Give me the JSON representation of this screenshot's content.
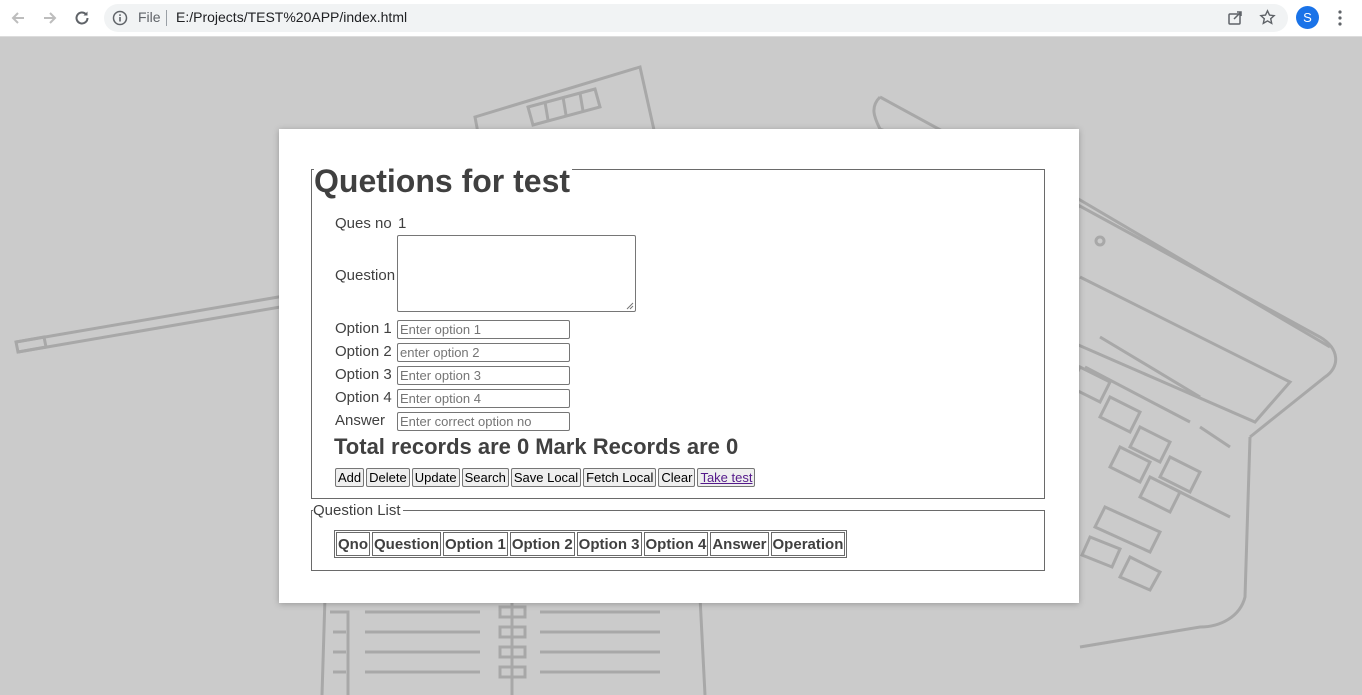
{
  "browser": {
    "scheme": "File",
    "url": "E:/Projects/TEST%20APP/index.html",
    "profile_initial": "S",
    "accent": "#1a73e8"
  },
  "form": {
    "title": "Quetions for test",
    "ques_no_label": "Ques no",
    "ques_no_value": "1",
    "question_label": "Question",
    "option1_label": "Option 1",
    "option1_placeholder": "Enter option 1",
    "option2_label": "Option 2",
    "option2_placeholder": "enter option 2",
    "option3_label": "Option 3",
    "option3_placeholder": "Enter option 3",
    "option4_label": "Option 4",
    "option4_placeholder": "Enter option 4",
    "answer_label": "Answer",
    "answer_placeholder": "Enter correct option no",
    "total_text": "Total records are 0",
    "mark_text": "Mark Records are 0"
  },
  "buttons": {
    "add": "Add",
    "delete": "Delete",
    "update": "Update",
    "search": "Search",
    "save_local": "Save Local",
    "fetch_local": "Fetch Local",
    "clear": "Clear",
    "take_test": "Take test"
  },
  "list": {
    "legend": "Question List",
    "headers": [
      "Qno",
      "Question",
      "Option 1",
      "Option 2",
      "Option 3",
      "Option 4",
      "Answer",
      "Operation"
    ]
  }
}
